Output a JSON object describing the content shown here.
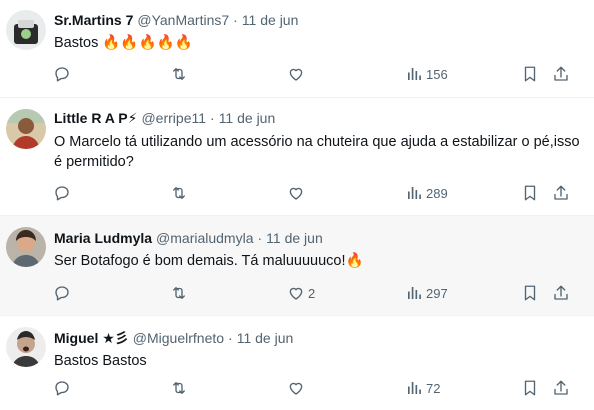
{
  "tweets": [
    {
      "name": "Sr.Martins 7",
      "handle": "@YanMartins7",
      "date": "11 de jun",
      "text": "Bastos 🔥🔥🔥🔥🔥",
      "replies": "",
      "retweets": "",
      "likes": "",
      "views": "156"
    },
    {
      "name": "Little R A P⚡",
      "handle": "@erripe11",
      "date": "11 de jun",
      "text": "O Marcelo tá utilizando um acessório na chuteira que ajuda a estabilizar o pé,isso é permitido?",
      "replies": "",
      "retweets": "",
      "likes": "",
      "views": "289"
    },
    {
      "name": "Maria Ludmyla",
      "handle": "@marialudmyla",
      "date": "11 de jun",
      "text": "Ser Botafogo é bom demais. Tá maluuuuuco!🔥",
      "replies": "",
      "retweets": "",
      "likes": "2",
      "views": "297"
    },
    {
      "name": "Miguel ★彡",
      "handle": "@Miguelrfneto",
      "date": "11 de jun",
      "text": "Bastos Bastos",
      "replies": "",
      "retweets": "",
      "likes": "",
      "views": "72"
    }
  ],
  "separator": "·",
  "icons": {
    "reply": "reply-icon",
    "retweet": "retweet-icon",
    "like": "heart-icon",
    "views": "views-chart-icon",
    "bookmark": "bookmark-icon",
    "share": "share-icon"
  },
  "colors": {
    "text": "#0f1419",
    "secondary": "#536471",
    "border": "#eff3f4",
    "hover_bg": "#f7f7f7"
  }
}
